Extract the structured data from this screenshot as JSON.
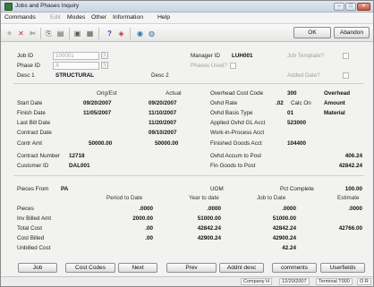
{
  "window": {
    "title": "Jobs and Phases Inquiry"
  },
  "menu": {
    "commands": "Commands",
    "edit": "Edit",
    "modes": "Modes",
    "other": "Other",
    "information": "Information",
    "help": "Help"
  },
  "toolbar": {
    "ok_label": "OK",
    "abandon_label": "Abandon"
  },
  "header": {
    "job_id_label": "Job ID",
    "job_id_value": "100001",
    "phase_id_label": "Phase ID",
    "phase_id_value": "A",
    "desc1_label": "Desc 1",
    "desc1_value": "STRUCTURAL",
    "desc2_label": "Desc 2",
    "manager_id_label": "Manager ID",
    "manager_id_value": "LUH001",
    "phases_used_label": "Phases Used?",
    "job_template_label": "Job Template?",
    "added_date_label": "Added Date?"
  },
  "dates": {
    "orig_est_header": "Orig/Est",
    "actual_header": "Actual",
    "start_label": "Start Date",
    "start_est": "09/20/2007",
    "start_actual": "09/20/2007",
    "finish_label": "Finish Date",
    "finish_est": "11/05/2007",
    "finish_actual": "11/10/2007",
    "last_bill_label": "Last Bill Date",
    "last_bill_actual": "11/20/2007",
    "contract_label": "Contract Date",
    "contract_actual": "09/10/2007",
    "contr_amt_label": "Contr Amt",
    "contr_amt_est": "50000.00",
    "contr_amt_actual": "50000.00",
    "contract_number_label": "Contract Number",
    "contract_number_value": "12718",
    "customer_id_label": "Customer ID",
    "customer_id_value": "DAL001"
  },
  "overhead": {
    "code_label": "Overhead Cost Code",
    "code_value": "300",
    "code_desc": "Overhead",
    "rate_label": "Ovhd Rate",
    "rate_value": ".02",
    "calc_on_label": "Calc On",
    "calc_on_value": "Amount",
    "basis_label": "Ovhd Basis Type",
    "basis_value": "01",
    "basis_desc": "Material",
    "applied_gl_label": "Applied Ovhd GL Acct",
    "applied_gl_value": "523000",
    "wip_label": "Work-in-Process Acct",
    "finished_label": "Finished Goods Acct",
    "finished_value": "104400",
    "accum_label": "Ovhd Accum to Post",
    "accum_value": "406.24",
    "fin_goods_label": "Fin Goods to Post",
    "fin_goods_value": "42842.24"
  },
  "pieces": {
    "pieces_from_label": "Pieces From",
    "pieces_from_value": "PA",
    "uom_label": "UOM",
    "pct_complete_label": "Pct Complete",
    "pct_complete_value": "100.00",
    "col_ptd": "Period to Date",
    "col_ytd": "Year to date",
    "col_jtd": "Job to Date",
    "col_est": "Estimate",
    "rows": [
      {
        "label": "Pieces",
        "ptd": ".0000",
        "ytd": ".0000",
        "jtd": ".0000",
        "est": ".0000"
      },
      {
        "label": "Inv Billed Amt",
        "ptd": "2000.00",
        "ytd": "51000.00",
        "jtd": "51000.00",
        "est": ""
      },
      {
        "label": "Total Cost",
        "ptd": ".00",
        "ytd": "42842.24",
        "jtd": "42842.24",
        "est": "42766.00"
      },
      {
        "label": "Cost Billed",
        "ptd": ".00",
        "ytd": "42900.24",
        "jtd": "42900.24",
        "est": ""
      },
      {
        "label": "Unbilled Cost",
        "ptd": "",
        "ytd": "",
        "jtd": "42.24",
        "est": ""
      }
    ]
  },
  "buttons": {
    "job": "Job",
    "cost_codes": "Cost Codes",
    "next": "Next",
    "prev": "Prev",
    "addnl_desc": "Addnl desc",
    "comments": "comments",
    "userfields": "Userfields"
  },
  "status": {
    "company": "Company H",
    "date": "12/20/2007",
    "terminal": "Terminal T000",
    "extra": "O R"
  }
}
